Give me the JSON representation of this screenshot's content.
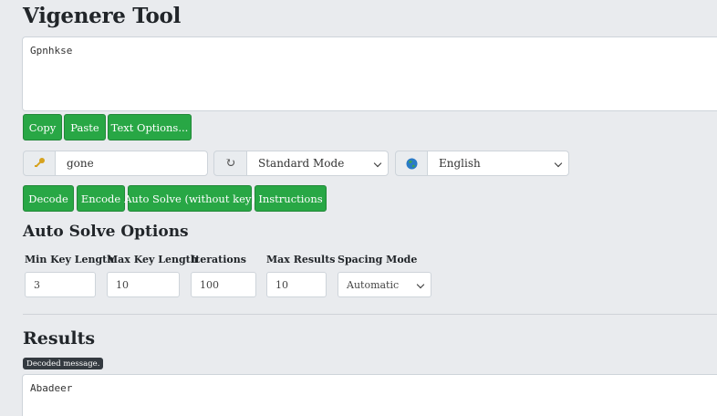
{
  "title": "Vigenere Tool",
  "input_text": "Gpnhkse",
  "text_buttons": {
    "copy": "Copy",
    "paste": "Paste",
    "text_options": "Text Options..."
  },
  "key": {
    "value": "gone"
  },
  "mode": {
    "selected": "Standard Mode"
  },
  "language": {
    "selected": "English"
  },
  "action_buttons": {
    "decode": "Decode",
    "encode": "Encode",
    "auto_solve": "Auto Solve (without key)",
    "instructions": "Instructions"
  },
  "auto_solve": {
    "heading": "Auto Solve Options",
    "min_key_length": {
      "label": "Min Key Length",
      "value": "3"
    },
    "max_key_length": {
      "label": "Max Key Length",
      "value": "10"
    },
    "iterations": {
      "label": "Iterations",
      "value": "100"
    },
    "max_results": {
      "label": "Max Results",
      "value": "10"
    },
    "spacing_mode": {
      "label": "Spacing Mode",
      "selected": "Automatic"
    }
  },
  "results": {
    "heading": "Results",
    "badge": "Decoded message.",
    "output_text": "Abadeer"
  },
  "colors": {
    "accent": "#28a745",
    "background": "#e9ebee",
    "badge": "#343a40"
  }
}
